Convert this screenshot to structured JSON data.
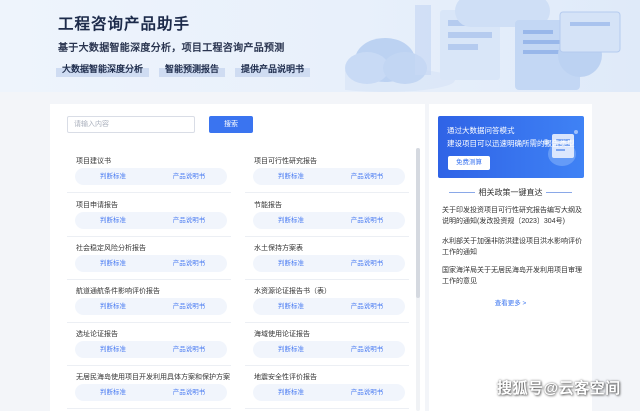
{
  "hero": {
    "title": "工程咨询产品助手",
    "subtitle": "基于大数据智能深度分析，项目工程咨询产品预测",
    "tabs": [
      "大数据智能深度分析",
      "智能预测报告",
      "提供产品说明书"
    ]
  },
  "search": {
    "placeholder": "请输入内容",
    "button": "搜索"
  },
  "cards": [
    {
      "title": "项目建议书",
      "btn1": "判断标准",
      "btn2": "产品说明书"
    },
    {
      "title": "项目可行性研究报告",
      "btn1": "判断标准",
      "btn2": "产品说明书"
    },
    {
      "title": "项目申请报告",
      "btn1": "判断标准",
      "btn2": "产品说明书"
    },
    {
      "title": "节能报告",
      "btn1": "判断标准",
      "btn2": "产品说明书"
    },
    {
      "title": "社会稳定风险分析报告",
      "btn1": "判断标准",
      "btn2": "产品说明书"
    },
    {
      "title": "水土保持方案表",
      "btn1": "判断标准",
      "btn2": "产品说明书"
    },
    {
      "title": "航道通航条件影响评价报告",
      "btn1": "判断标准",
      "btn2": "产品说明书"
    },
    {
      "title": "水资源论证报告书（表）",
      "btn1": "判断标准",
      "btn2": "产品说明书"
    },
    {
      "title": "选址论证报告",
      "btn1": "判断标准",
      "btn2": "产品说明书"
    },
    {
      "title": "海域使用论证报告",
      "btn1": "判断标准",
      "btn2": "产品说明书"
    },
    {
      "title": "无居民海岛使用项目开发利用具体方案和保护方案",
      "btn1": "判断标准",
      "btn2": "产品说明书"
    },
    {
      "title": "地震安全性评价报告",
      "btn1": "判断标准",
      "btn2": "产品说明书"
    }
  ],
  "banner": {
    "line1": "通过大数据问答模式",
    "line2": "建设项目可以迅速明确所需的报告类型",
    "button": "免费测算"
  },
  "policy": {
    "title": "相关政策一键直达",
    "items": [
      "关于印发投资项目可行性研究报告编写大纲及说明的通知(发改投资规〔2023〕304号)",
      "水利部关于加强非防洪建设项目洪水影响评价工作的通知",
      "国家海洋局关于无居民海岛开发利用项目审理工作的意见"
    ],
    "more": "查看更多 >"
  },
  "watermark": "搜狐号@云客空间",
  "colors": {
    "accent": "#3a74f0",
    "hero_bg": "#eef4fc",
    "page_bg": "#f3f5f9"
  }
}
